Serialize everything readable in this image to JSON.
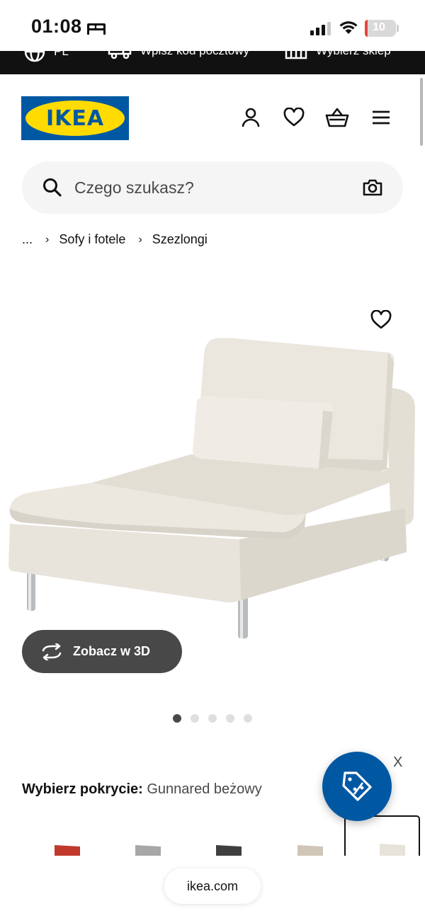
{
  "status_bar": {
    "time": "01:08",
    "battery": "10",
    "battery_level": 0.1
  },
  "top_strip": {
    "language": "PL",
    "postcode": "Wpisz kod pocztowy",
    "store": "Wybierz sklep"
  },
  "header": {
    "logo": "IKEA"
  },
  "search": {
    "placeholder": "Czego szukasz?"
  },
  "breadcrumb": {
    "ellipsis": "...",
    "items": [
      "Sofy i fotele",
      "Szezlongi"
    ]
  },
  "product": {
    "view_3d_label": "Zobacz w 3D",
    "image_count": 5,
    "active_image": 1
  },
  "fabric": {
    "label": "Wybierz pokrycie:",
    "value": "Gunnared beżowy",
    "swatch_colors": [
      "#c0392b",
      "#a0a0a0",
      "#3a3a3a",
      "#cfc6b8",
      "#e5e1d8"
    ],
    "selected_index": 4
  },
  "promo": {
    "close_label": "X",
    "color": "#0058a3"
  },
  "browser": {
    "url": "ikea.com"
  }
}
